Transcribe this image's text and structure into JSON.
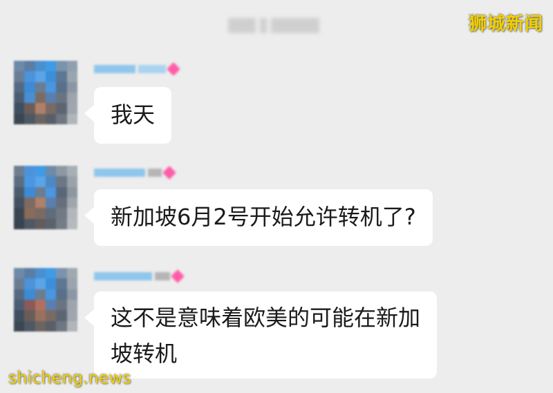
{
  "watermarks": {
    "top_right": "狮城新闻",
    "bottom_left": "shicheng.news"
  },
  "messages": [
    {
      "text": "我天"
    },
    {
      "text": "新加坡6月2号开始允许转机了?"
    },
    {
      "text_line1": "这不是意味着欧美的可能在新加",
      "text_line2": "坡转机"
    }
  ],
  "colors": {
    "background": "#ededed",
    "bubble": "#ffffff",
    "watermark": "#f2d000",
    "nickname_blur": "#8fc6ec",
    "nickname_badge": "#ff5ca8"
  }
}
